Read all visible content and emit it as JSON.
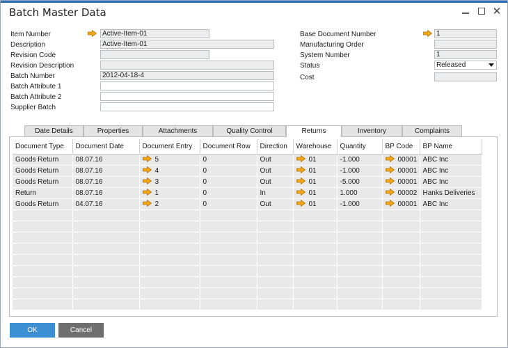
{
  "window": {
    "title": "Batch Master Data",
    "controls": [
      "minimize-icon",
      "maximize-icon",
      "close-icon"
    ]
  },
  "left_form": {
    "item_number": {
      "label": "Item Number",
      "value": "Active-Item-01"
    },
    "description": {
      "label": "Description",
      "value": "Active-Item-01"
    },
    "revision_code": {
      "label": "Revision Code",
      "value": ""
    },
    "revision_description": {
      "label": "Revision Description",
      "value": ""
    },
    "batch_number": {
      "label": "Batch Number",
      "value": "2012-04-18-4"
    },
    "batch_attribute_1": {
      "label": "Batch Attribute 1",
      "value": ""
    },
    "batch_attribute_2": {
      "label": "Batch Attribute 2",
      "value": ""
    },
    "supplier_batch": {
      "label": "Supplier Batch",
      "value": ""
    }
  },
  "right_form": {
    "base_document_number": {
      "label": "Base Document Number",
      "value": "1"
    },
    "manufacturing_order": {
      "label": "Manufacturing Order",
      "value": ""
    },
    "system_number": {
      "label": "System Number",
      "value": "1"
    },
    "status": {
      "label": "Status",
      "value": "Released"
    },
    "cost": {
      "label": "Cost",
      "value": ""
    }
  },
  "tabs": [
    {
      "label": "Date Details",
      "active": false
    },
    {
      "label": "Properties",
      "active": false
    },
    {
      "label": "Attachments",
      "active": false
    },
    {
      "label": "Quality Control",
      "active": false
    },
    {
      "label": "Returns",
      "active": true
    },
    {
      "label": "Inventory",
      "active": false
    },
    {
      "label": "Complaints",
      "active": false
    }
  ],
  "grid": {
    "columns": [
      "Document Type",
      "Document Date",
      "Document Entry",
      "Document Row",
      "Direction",
      "Warehouse",
      "Quantity",
      "BP Code",
      "BP Name"
    ],
    "rows": [
      {
        "document_type": "Goods Return",
        "document_date": "08.07.16",
        "document_entry": "5",
        "document_row": "0",
        "direction": "Out",
        "warehouse": "01",
        "quantity": "-1.000",
        "bp_code": "00001",
        "bp_name": "ABC Inc"
      },
      {
        "document_type": "Goods Return",
        "document_date": "08.07.16",
        "document_entry": "4",
        "document_row": "0",
        "direction": "Out",
        "warehouse": "01",
        "quantity": "-1.000",
        "bp_code": "00001",
        "bp_name": "ABC Inc"
      },
      {
        "document_type": "Goods Return",
        "document_date": "08.07.16",
        "document_entry": "3",
        "document_row": "0",
        "direction": "Out",
        "warehouse": "01",
        "quantity": "-5.000",
        "bp_code": "00001",
        "bp_name": "ABC Inc"
      },
      {
        "document_type": "Return",
        "document_date": "08.07.16",
        "document_entry": "1",
        "document_row": "0",
        "direction": "In",
        "warehouse": "01",
        "quantity": "1.000",
        "bp_code": "00002",
        "bp_name": "Hanks Deliveries"
      },
      {
        "document_type": "Goods Return",
        "document_date": "04.07.16",
        "document_entry": "2",
        "document_row": "0",
        "direction": "Out",
        "warehouse": "01",
        "quantity": "-1.000",
        "bp_code": "00001",
        "bp_name": "ABC Inc"
      }
    ],
    "empty_rows": 9
  },
  "buttons": {
    "ok": "OK",
    "cancel": "Cancel"
  },
  "colors": {
    "accent": "#2b6cb8",
    "ok_button": "#3d8fd3",
    "cancel_button": "#6f6f6f",
    "link_arrow": "#f0a818",
    "grid_cell": "#e9e9e9"
  }
}
